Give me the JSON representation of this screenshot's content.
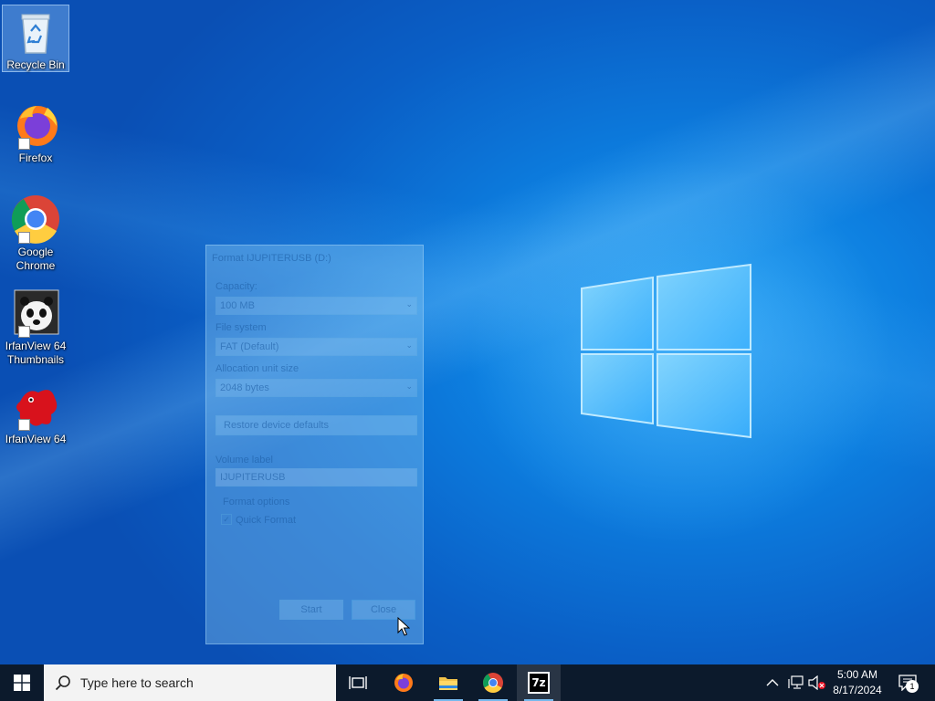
{
  "desktop": {
    "icons": [
      {
        "label": "Recycle Bin",
        "icon": "recycle-bin-icon",
        "selected": true
      },
      {
        "label": "Firefox",
        "icon": "firefox-icon"
      },
      {
        "label": "Google\nChrome",
        "icon": "chrome-icon"
      },
      {
        "label": "IrfanView 64\nThumbnails",
        "icon": "irfanview-thumbnails-icon"
      },
      {
        "label": "IrfanView 64",
        "icon": "irfanview-icon"
      }
    ]
  },
  "format_dialog": {
    "title": "Format IJUPITERUSB (D:)",
    "capacity_label": "Capacity:",
    "capacity_value": "100 MB",
    "file_system_label": "File system",
    "file_system_value": "FAT (Default)",
    "allocation_label": "Allocation unit size",
    "allocation_value": "2048 bytes",
    "restore_button": "Restore device defaults",
    "volume_label": "Volume label",
    "volume_value": "IJUPITERUSB",
    "format_options_label": "Format options",
    "quick_format_label": "Quick Format",
    "quick_format_checked": true,
    "start_button": "Start",
    "close_button": "Close"
  },
  "taskbar": {
    "search_placeholder": "Type here to search",
    "pinned": [
      "task-view-icon",
      "firefox-icon",
      "file-explorer-icon",
      "chrome-icon",
      "7zip-icon"
    ],
    "sevenzip_label": "7z",
    "clock_time": "5:00 AM",
    "clock_date": "8/17/2024",
    "notification_count": "1"
  },
  "colors": {
    "taskbar": "#0c1a2c",
    "desktop_accent": "#0d7fe0"
  }
}
